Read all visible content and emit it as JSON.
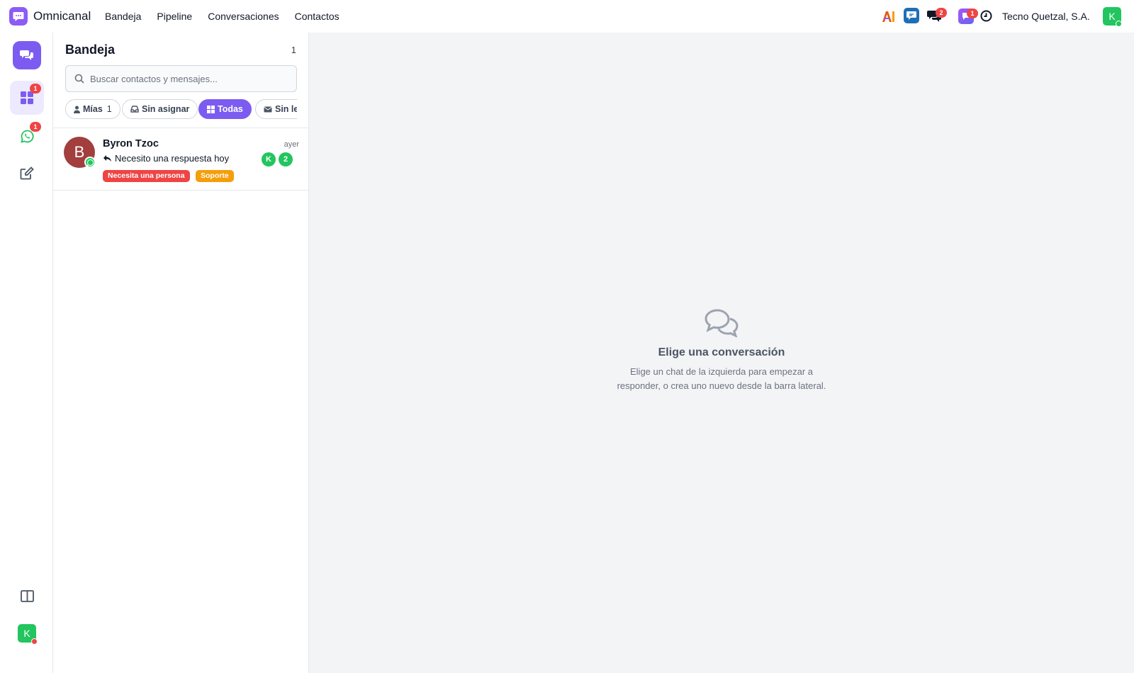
{
  "app": {
    "name": "Omnicanal"
  },
  "nav": [
    "Bandeja",
    "Pipeline",
    "Conversaciones",
    "Contactos"
  ],
  "topbar": {
    "chat_badge": "2",
    "purple_badge": "1",
    "company": "Tecno Quetzal, S.A.",
    "avatar_initial": "K",
    "colors": {
      "brand": "#8b5cf6",
      "accent": "#7c5cf0",
      "online": "#22c55e",
      "badge": "#ef4444"
    }
  },
  "rail": {
    "inbox_badge": "1",
    "whatsapp_badge": "1",
    "avatar_initial": "K"
  },
  "inbox": {
    "title": "Bandeja",
    "count": "1",
    "search_placeholder": "Buscar contactos y mensajes...",
    "filters": [
      {
        "label": "Mías",
        "count": "1"
      },
      {
        "label": "Sin asignar"
      },
      {
        "label": "Todas",
        "active": true
      },
      {
        "label": "Sin le"
      }
    ],
    "conversations": [
      {
        "initial": "B",
        "name": "Byron Tzoc",
        "time": "ayer",
        "message": "Necesito una respuesta hoy",
        "agent_initial": "K",
        "unread": "2",
        "tags": [
          {
            "label": "Necesita una persona",
            "color": "#ef4444"
          },
          {
            "label": "Soporte",
            "color": "#f59e0b"
          }
        ]
      }
    ]
  },
  "empty_state": {
    "title": "Elige una conversación",
    "line1": "Elige un chat de la izquierda para empezar a",
    "line2": "responder, o crea uno nuevo desde la barra lateral."
  }
}
